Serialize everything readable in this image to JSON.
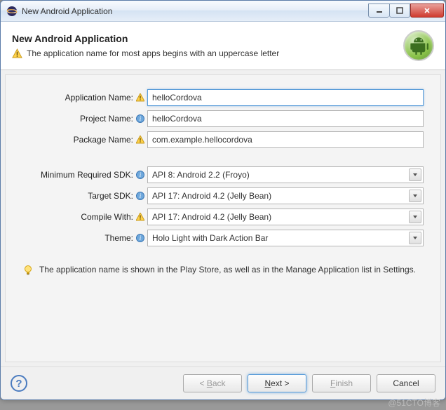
{
  "window": {
    "title": "New Android Application"
  },
  "header": {
    "title": "New Android Application",
    "message": "The application name for most apps begins with an uppercase letter"
  },
  "form": {
    "appName": {
      "label": "Application Name:",
      "value": "helloCordova",
      "iconType": "warn"
    },
    "projectName": {
      "label": "Project Name:",
      "value": "helloCordova",
      "iconType": "info"
    },
    "packageName": {
      "label": "Package Name:",
      "value": "com.example.hellocordova",
      "iconType": "warn"
    },
    "minSdk": {
      "label": "Minimum Required SDK:",
      "value": "API 8: Android 2.2 (Froyo)",
      "iconType": "info"
    },
    "targetSdk": {
      "label": "Target SDK:",
      "value": "API 17: Android 4.2 (Jelly Bean)",
      "iconType": "info"
    },
    "compileWith": {
      "label": "Compile With:",
      "value": "API 17: Android 4.2 (Jelly Bean)",
      "iconType": "warn"
    },
    "theme": {
      "label": "Theme:",
      "value": "Holo Light with Dark Action Bar",
      "iconType": "info"
    }
  },
  "hint": "The application name is shown in the Play Store, as well as in the Manage Application list in Settings.",
  "buttons": {
    "back": "< Back",
    "next": "Next >",
    "finish": "Finish",
    "cancel": "Cancel"
  },
  "watermark": "@51CTO博客"
}
